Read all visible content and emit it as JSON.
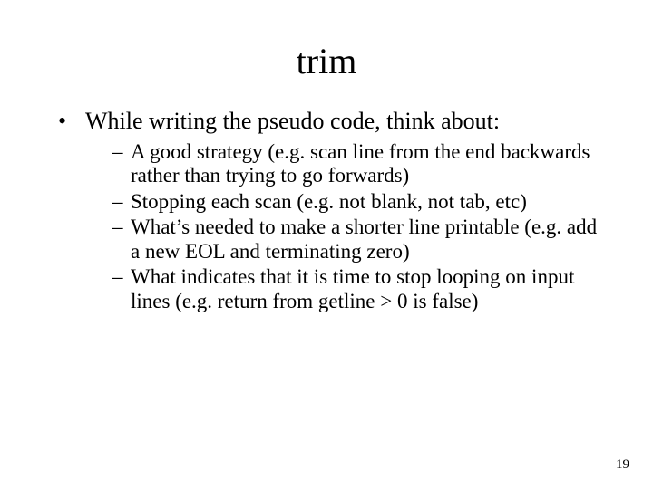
{
  "title": "trim",
  "bullet_main": "While writing the pseudo code, think about:",
  "sub_bullets": [
    "A good strategy (e.g. scan line from the end backwards rather than trying to go forwards)",
    "Stopping each scan (e.g. not blank, not tab, etc)",
    "What’s needed to make a shorter line printable (e.g. add a new EOL and terminating zero)",
    "What indicates that it is time to stop looping on input lines (e.g. return from getline > 0 is false)"
  ],
  "page_number": "19"
}
